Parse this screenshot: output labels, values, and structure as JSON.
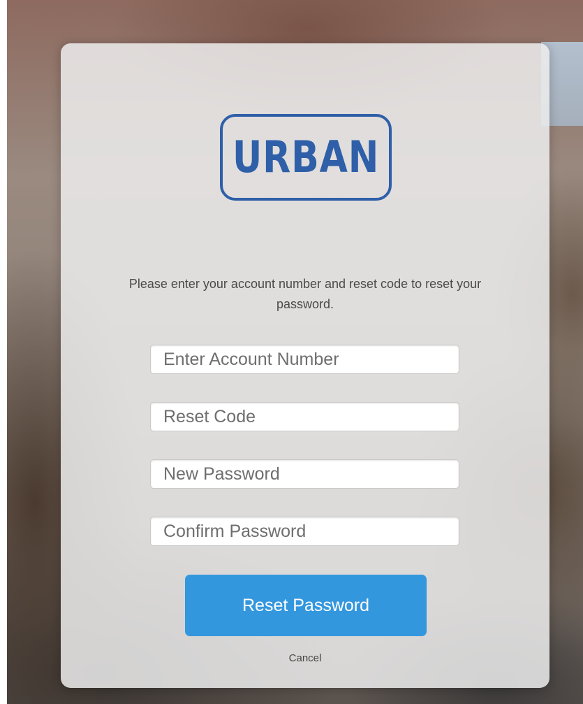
{
  "brand": {
    "logo_text": "URBAN",
    "logo_color": "#2f5fa8"
  },
  "form": {
    "instructions": "Please enter your account number and reset code to reset your password.",
    "fields": [
      {
        "placeholder": "Enter Account Number",
        "value": ""
      },
      {
        "placeholder": "Reset Code",
        "value": ""
      },
      {
        "placeholder": "New Password",
        "value": ""
      },
      {
        "placeholder": "Confirm Password",
        "value": ""
      }
    ],
    "submit_label": "Reset Password",
    "cancel_label": "Cancel"
  },
  "colors": {
    "button": "#3397de",
    "card": "#ececec"
  }
}
